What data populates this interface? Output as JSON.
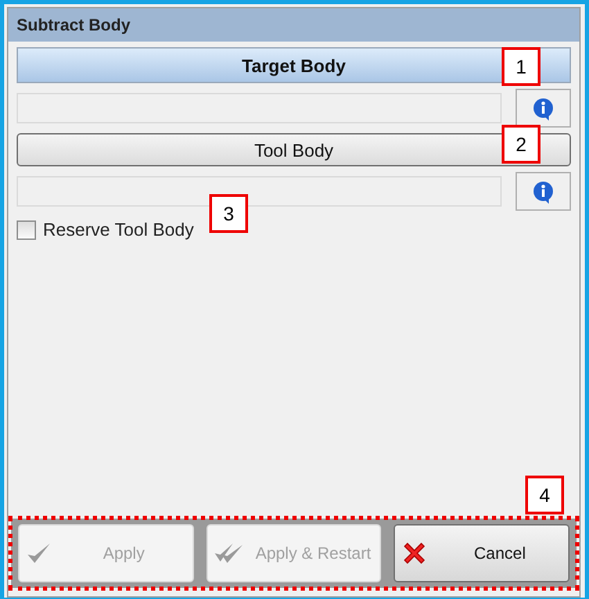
{
  "window": {
    "title": "Subtract Body"
  },
  "sections": [
    {
      "kind": "header",
      "label": "Target Body"
    },
    {
      "kind": "button",
      "label": "Tool Body"
    }
  ],
  "checkbox": {
    "label": "Reserve Tool Body",
    "checked": false
  },
  "buttons": [
    {
      "label": "Apply",
      "disabled": true
    },
    {
      "label": "Apply & Restart",
      "disabled": true
    },
    {
      "label": "Cancel",
      "disabled": false
    }
  ],
  "callouts": [
    "1",
    "2",
    "3",
    "4"
  ]
}
